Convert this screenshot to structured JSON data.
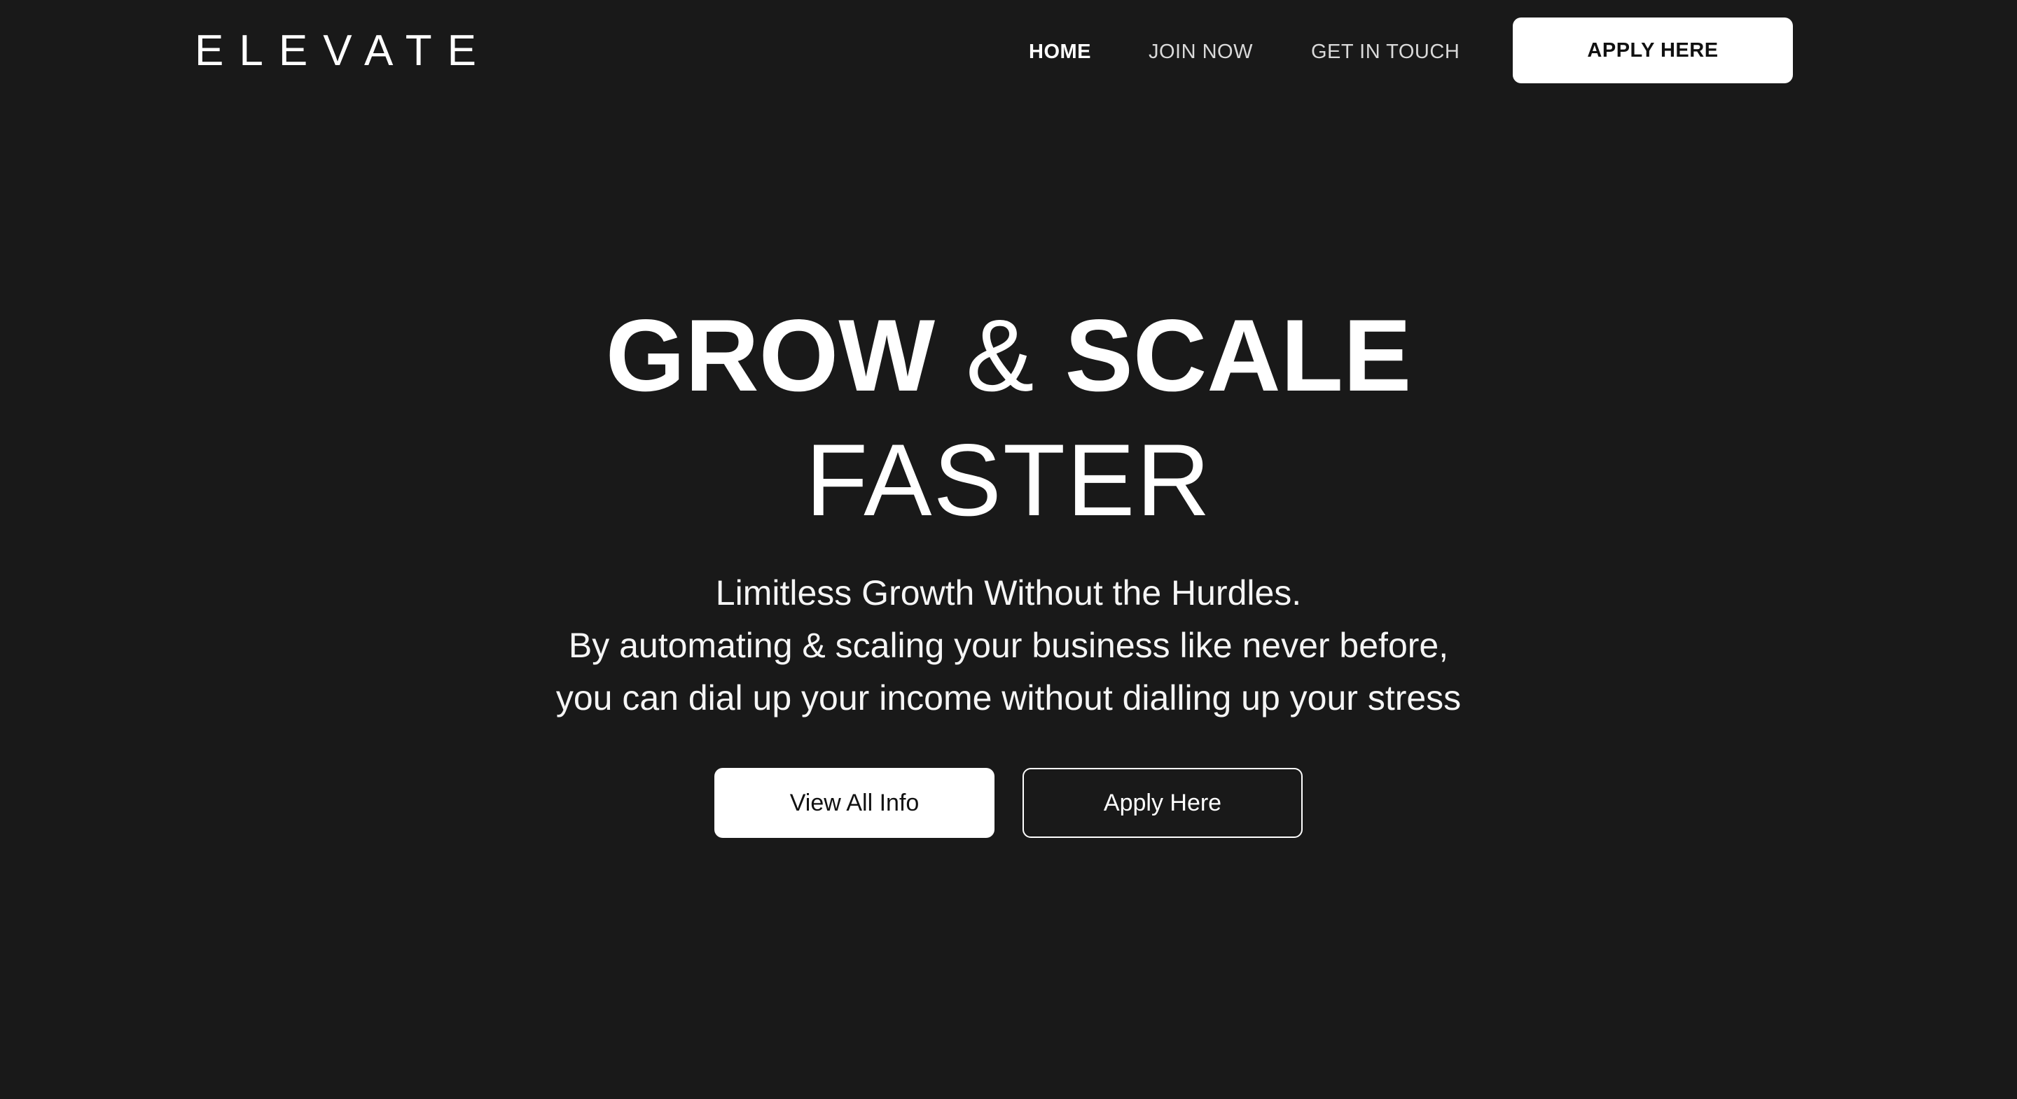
{
  "header": {
    "logo_text": "ELEVATE",
    "nav": [
      {
        "label": "HOME",
        "active": true
      },
      {
        "label": "JOIN NOW",
        "active": false
      },
      {
        "label": "GET IN TOUCH",
        "active": false
      }
    ],
    "cta_label": "APPLY HERE"
  },
  "hero": {
    "title_part1": "GROW",
    "title_amp": "&",
    "title_part2": "SCALE",
    "title_line2": "FASTER",
    "subtitle_lines": [
      "Limitless Growth Without the Hurdles.",
      "By automating & scaling your business like never before,",
      "you can dial up your income without dialling up your stress"
    ],
    "primary_button": "View All Info",
    "secondary_button": "Apply Here"
  },
  "colors": {
    "background": "#191919",
    "text": "#ffffff",
    "button_bg": "#ffffff",
    "button_text": "#111111"
  }
}
